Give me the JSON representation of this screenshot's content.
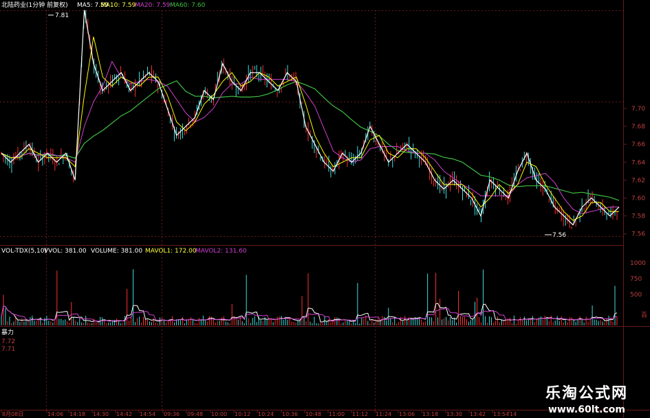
{
  "header": {
    "stock_label": "北陆药业(1分钟 前复权)",
    "ma5": "MA5: 7.59",
    "ma10": "MA10: 7.59",
    "ma20": "MA20: 7.59",
    "ma60": "MA60: 7.60"
  },
  "price_axis": [
    "7.70",
    "7.68",
    "7.66",
    "7.64",
    "7.62",
    "7.60",
    "7.58",
    "7.56"
  ],
  "high_label": "7.81",
  "low_label": "7.56",
  "volume_header": {
    "indicator": "VOL-TDX(5,10)",
    "vvol": "VVOL: 381.00",
    "volume": "VOLUME: 381.00",
    "mavol1": "MAVOL1: 172.00",
    "mavol2": "MAVOL2: 131.60"
  },
  "volume_axis": [
    "1000",
    "750",
    "500"
  ],
  "volume_unit": "百",
  "third_panel": {
    "label": "暴力",
    "values": [
      "7.72",
      "7.71"
    ]
  },
  "time_axis": [
    "8月08日",
    "14:06",
    "14:18",
    "14:30",
    "14:42",
    "14:54",
    "09:36",
    "09:48",
    "10:00",
    "10:12",
    "10:24",
    "10:36",
    "10:48",
    "11:00",
    "11:12",
    "11:24",
    "13:06",
    "13:18",
    "13:30",
    "13:42",
    "13:54",
    "14"
  ],
  "watermark": {
    "title": "乐淘公式网",
    "url": "www.60lt.com"
  },
  "colors": {
    "ma5": "#ffffff",
    "ma10": "#ffff00",
    "ma20": "#d040d0",
    "ma60": "#40c040",
    "grid": "#6a1a1a",
    "axis_text": "#c04040",
    "up": "#ff3030",
    "down": "#40e0e0"
  },
  "chart_data": {
    "type": "line",
    "price_samples": [
      7.65,
      7.64,
      7.65,
      7.66,
      7.64,
      7.65,
      7.64,
      7.65,
      7.62,
      7.81,
      7.75,
      7.72,
      7.73,
      7.74,
      7.72,
      7.73,
      7.74,
      7.73,
      7.7,
      7.67,
      7.68,
      7.69,
      7.72,
      7.71,
      7.75,
      7.73,
      7.72,
      7.74,
      7.74,
      7.73,
      7.72,
      7.74,
      7.73,
      7.68,
      7.66,
      7.64,
      7.63,
      7.65,
      7.64,
      7.65,
      7.68,
      7.66,
      7.64,
      7.65,
      7.66,
      7.65,
      7.64,
      7.62,
      7.61,
      7.62,
      7.61,
      7.6,
      7.58,
      7.62,
      7.61,
      7.6,
      7.63,
      7.65,
      7.62,
      7.61,
      7.59,
      7.58,
      7.57,
      7.59,
      7.6,
      7.59,
      7.58,
      7.59
    ]
  }
}
